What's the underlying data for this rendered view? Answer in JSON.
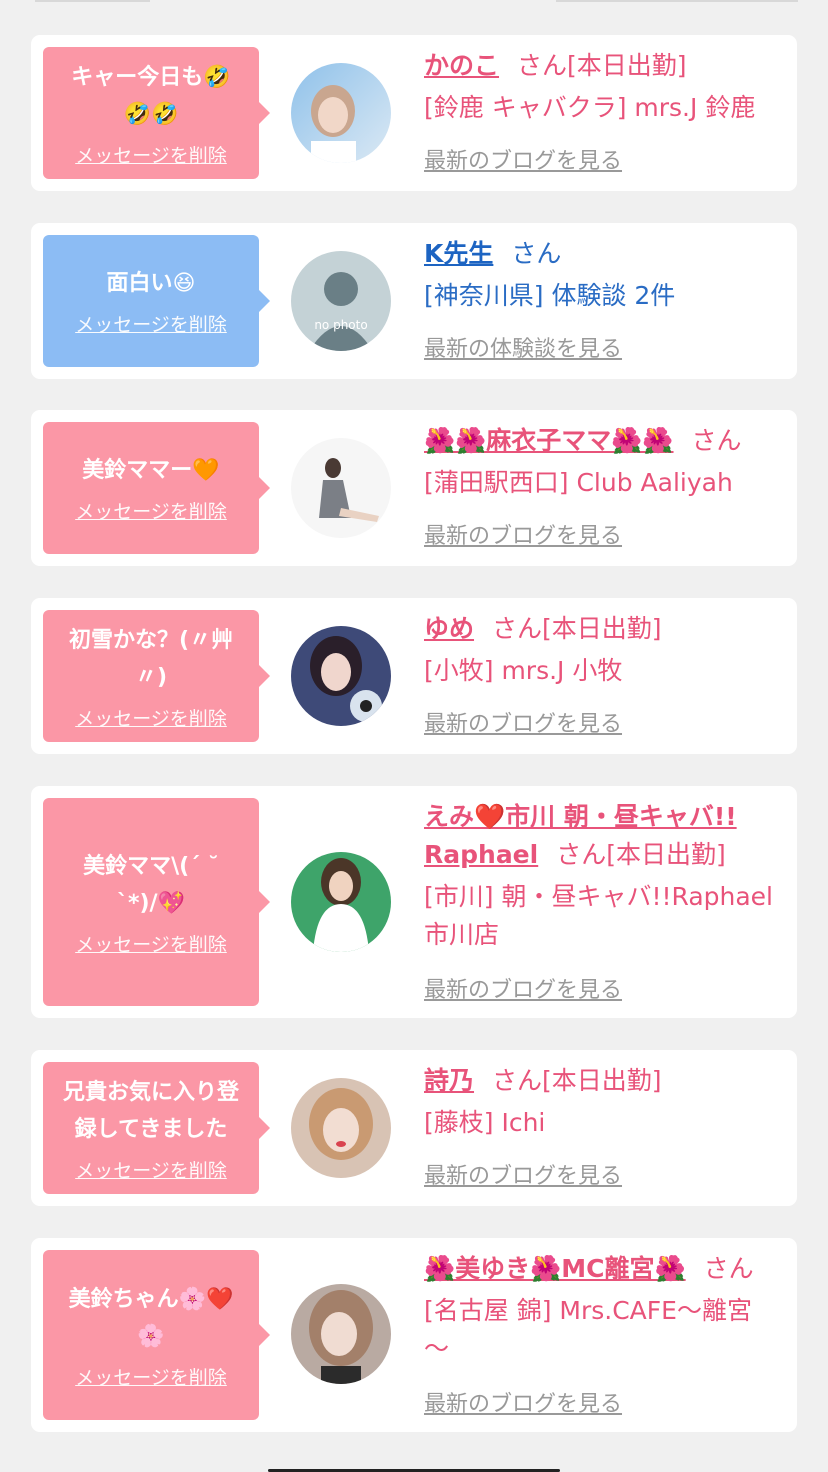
{
  "delete_label": "メッセージを削除",
  "san": "さん",
  "colors": {
    "pink": "#fb97a6",
    "blue": "#8cbcf4",
    "name_pink": "#e8537a",
    "name_blue": "#1d64c2",
    "link_gray": "#999999"
  },
  "cards": [
    {
      "message": "キャー今日も🤣\n🤣🤣",
      "name": "かのこ",
      "status": "[本日出勤]",
      "detail": "[鈴鹿 キャバクラ] mrs.J 鈴鹿",
      "link": "最新のブログを見る",
      "avatar_icon": "profile-photo"
    },
    {
      "message": "面白い😆",
      "name": "K先生",
      "status": "",
      "detail": "[神奈川県] 体験談 2件",
      "link": "最新の体験談を見る",
      "avatar_icon": "no-photo-silhouette",
      "avatar_text": "no photo"
    },
    {
      "message": "美鈴ママー🧡",
      "name": "🌺🌺麻衣子ママ🌺🌺",
      "status": "",
      "detail": "[蒲田駅西口] Club Aaliyah",
      "link": "最新のブログを見る",
      "avatar_icon": "profile-photo"
    },
    {
      "message": "初雪かな？(〃艸\n〃)",
      "name": "ゆめ",
      "status": "[本日出勤]",
      "detail": "[小牧] mrs.J 小牧",
      "link": "最新のブログを見る",
      "avatar_icon": "profile-photo"
    },
    {
      "message": "美鈴ママ\\(´ ˘\n`*)/💖",
      "name": "えみ❤️市川 朝・昼キャバ!!",
      "name2": "Raphael",
      "status": "[本日出勤]",
      "detail": "[市川] 朝・昼キャバ!!Raphael",
      "detail2": "市川店",
      "link": "最新のブログを見る",
      "avatar_icon": "profile-photo"
    },
    {
      "message": "兄貴お気に入り登\n録してきました",
      "name": "詩乃",
      "status": "[本日出勤]",
      "detail": "[藤枝] Ichi",
      "link": "最新のブログを見る",
      "avatar_icon": "profile-photo"
    },
    {
      "message": "美鈴ちゃん🌸❤️\n🌸",
      "name": "🌺美ゆき🌺MC離宮🌺",
      "status": "",
      "detail": "[名古屋 錦] Mrs.CAFE〜離宮",
      "detail2": "〜",
      "link": "最新のブログを見る",
      "avatar_icon": "profile-photo"
    }
  ]
}
